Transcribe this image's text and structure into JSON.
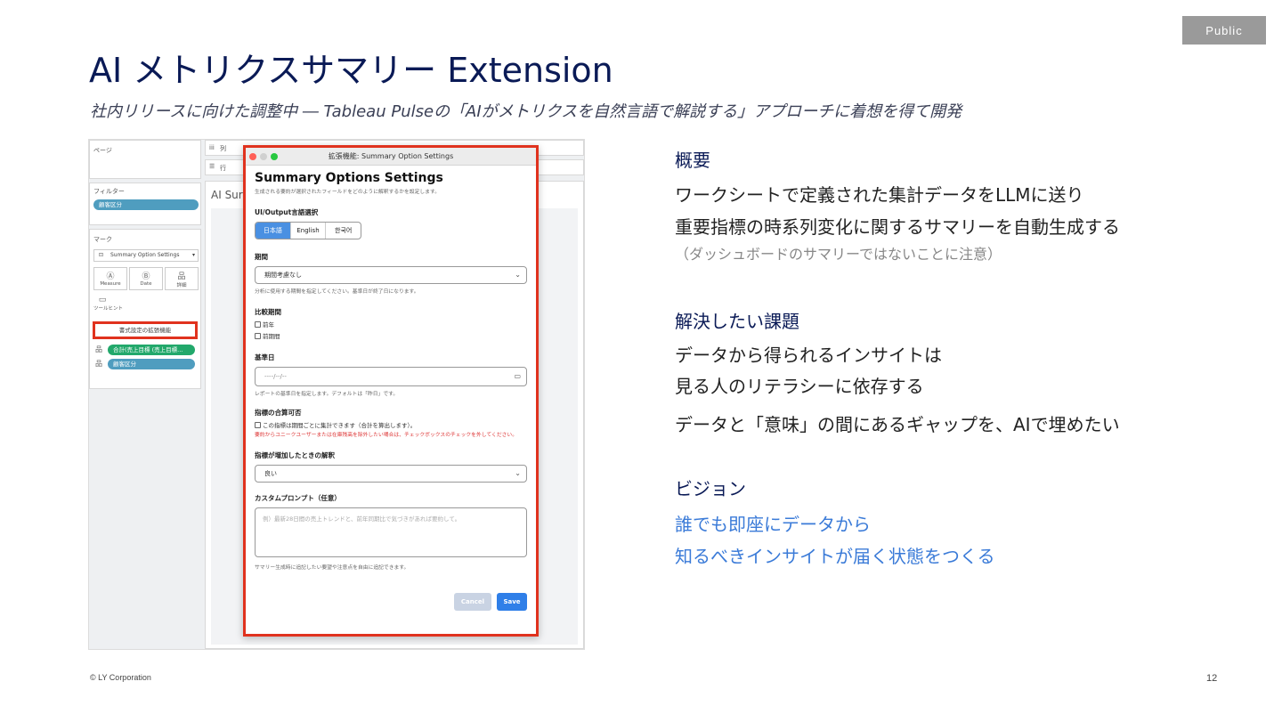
{
  "badge": "Public",
  "title": "AI メトリクスサマリー Extension",
  "subtitle": "社内リリースに向けた調整中 ― Tableau Pulseの「AIがメトリクスを自然言語で解説する」アプローチに着想を得て開発",
  "screenshot": {
    "pages_label": "ページ",
    "columns_label": "列",
    "rows_label": "行",
    "filters_label": "フィルター",
    "filter_pill": "顧客区分",
    "marks_label": "マーク",
    "marks_dropdown": "Summary Option Settings",
    "mark_buttons": [
      {
        "glyph": "Ⓐ",
        "label": "Measure"
      },
      {
        "glyph": "Ⓑ",
        "label": "Date"
      },
      {
        "glyph": "品",
        "label": "詳細"
      }
    ],
    "tooltip_label": "ツールヒント",
    "format_extension_button": "書式設定の拡張機能",
    "measure_pill": "合計(売上目標 (売上目標...",
    "segment_pill": "顧客区分",
    "sheet_title": "AI Sur",
    "dialog": {
      "window_title": "拡張機能: Summary Option Settings",
      "heading": "Summary Options Settings",
      "description": "生成される要約が選択されたフィールドをどのように解釈するかを設定します。",
      "lang_label": "UI/Output言語選択",
      "lang_options": [
        "日本語",
        "English",
        "한국어"
      ],
      "period_label": "期間",
      "period_value": "期間考慮なし",
      "period_hint": "分析に使用する期間を指定してください。基準日が終了日になります。",
      "compare_label": "比較期間",
      "compare_options": [
        "前年",
        "前期間"
      ],
      "base_date_label": "基準日",
      "base_date_value": "----/--/--",
      "base_date_hint": "レポートの基準日を指定します。デフォルトは「昨日」です。",
      "sum_label": "指標の合算可否",
      "sum_check": "この指標は期間ごとに集計できます（合計を算出します）。",
      "sum_warning": "要約からユニークユーザーまたは在庫残高を除外したい場合は、チェックボックスのチェックを外してください。",
      "increase_label": "指標が増加したときの解釈",
      "increase_value": "良い",
      "prompt_label": "カスタムプロンプト（任意）",
      "prompt_placeholder": "例）最新28日間の売上トレンドと、前年同期比で気づきがあれば要約して。",
      "prompt_hint": "サマリー生成時に追記したい要望や注意点を自由に追記できます。",
      "cancel": "Cancel",
      "save": "Save"
    }
  },
  "overview": {
    "heading": "概要",
    "line1": "ワークシートで定義された集計データをLLMに送り",
    "line2": "重要指標の時系列変化に関するサマリーを自動生成する",
    "note": "（ダッシュボードのサマリーではないことに注意）"
  },
  "problem": {
    "heading": "解決したい課題",
    "line1": "データから得られるインサイトは",
    "line2": "見る人のリテラシーに依存する",
    "line3": "データと「意味」の間にあるギャップを、AIで埋めたい"
  },
  "vision": {
    "heading": "ビジョン",
    "line1": "誰でも即座にデータから",
    "line2": "知るべきインサイトが届く状態をつくる"
  },
  "footer": {
    "copyright": "© LY Corporation",
    "page": "12"
  },
  "colors": {
    "title": "#0a1a56",
    "accent_blue": "#3b7bd8",
    "highlight_red": "#e0321e",
    "pill_blue": "#4f9dbf",
    "pill_green": "#22a86b"
  }
}
